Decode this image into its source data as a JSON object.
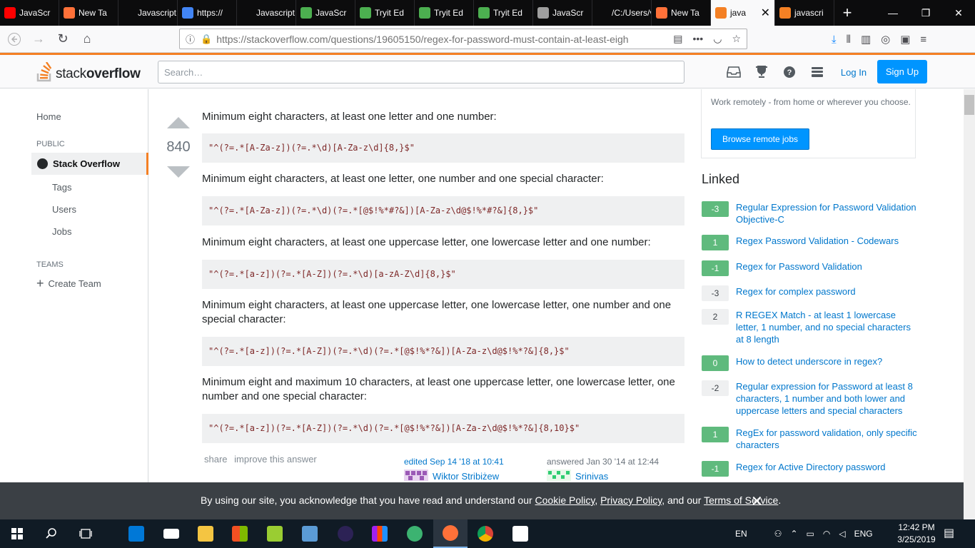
{
  "browser": {
    "tabs": [
      {
        "label": "JavaScr",
        "icon": "youtube-icon",
        "color": "#ff0000"
      },
      {
        "label": "New Ta",
        "icon": "firefox-icon",
        "color": "#ff7139"
      },
      {
        "label": "Javascript F",
        "icon": "blank-icon",
        "color": "#0c0c0d"
      },
      {
        "label": "https://",
        "icon": "google-icon",
        "color": "#4285f4"
      },
      {
        "label": "Javascript F",
        "icon": "blank-icon",
        "color": "#0c0c0d"
      },
      {
        "label": "JavaScr",
        "icon": "tryit-icon",
        "color": "#4caf50"
      },
      {
        "label": "Tryit Ed",
        "icon": "tryit-icon",
        "color": "#4caf50"
      },
      {
        "label": "Tryit Ed",
        "icon": "tryit-icon",
        "color": "#4caf50"
      },
      {
        "label": "Tryit Ed",
        "icon": "tryit-icon",
        "color": "#4caf50"
      },
      {
        "label": "JavaScr",
        "icon": "page-icon",
        "color": "#9e9e9e"
      },
      {
        "label": "/C:/Users/v",
        "icon": "blank-icon",
        "color": "#0c0c0d"
      },
      {
        "label": "New Ta",
        "icon": "firefox-icon",
        "color": "#ff7139"
      },
      {
        "label": "java",
        "icon": "stackoverflow-icon",
        "color": "#f48024",
        "active": true
      },
      {
        "label": "javascri",
        "icon": "stackoverflow-icon",
        "color": "#f48024"
      }
    ],
    "url": "https://stackoverflow.com/questions/19605150/regex-for-password-must-contain-at-least-eigh"
  },
  "header": {
    "logo_light": "stack",
    "logo_bold": "overflow",
    "search_placeholder": "Search…",
    "login": "Log In",
    "signup": "Sign Up",
    "accent": "#f48024"
  },
  "leftnav": {
    "home": "Home",
    "public": "PUBLIC",
    "stack_overflow": "Stack Overflow",
    "tags": "Tags",
    "users": "Users",
    "jobs": "Jobs",
    "teams": "TEAMS",
    "create_team": "Create Team"
  },
  "answer": {
    "votes": "840",
    "blocks": [
      {
        "text": "Minimum eight characters, at least one letter and one number:",
        "code": "\"^(?=.*[A-Za-z])(?=.*\\d)[A-Za-z\\d]{8,}$\""
      },
      {
        "text": "Minimum eight characters, at least one letter, one number and one special character:",
        "code": "\"^(?=.*[A-Za-z])(?=.*\\d)(?=.*[@$!%*#?&])[A-Za-z\\d@$!%*#?&]{8,}$\""
      },
      {
        "text": "Minimum eight characters, at least one uppercase letter, one lowercase letter and one number:",
        "code": "\"^(?=.*[a-z])(?=.*[A-Z])(?=.*\\d)[a-zA-Z\\d]{8,}$\""
      },
      {
        "text": "Minimum eight characters, at least one uppercase letter, one lowercase letter, one number and one special character:",
        "code": "\"^(?=.*[a-z])(?=.*[A-Z])(?=.*\\d)(?=.*[@$!%*?&])[A-Za-z\\d@$!%*?&]{8,}$\""
      },
      {
        "text": "Minimum eight and maximum 10 characters, at least one uppercase letter, one lowercase letter, one number and one special character:",
        "code": "\"^(?=.*[a-z])(?=.*[A-Z])(?=.*\\d)(?=.*[@$!%*?&])[A-Za-z\\d@$!%*?&]{8,10}$\""
      }
    ],
    "share": "share",
    "improve": "improve this answer",
    "edited": "edited Sep 14 '18 at 10:41",
    "editor": "Wiktor Stribiżew",
    "answered": "answered Jan 30 '14 at 12:44",
    "author": "Srinivas"
  },
  "sidebar": {
    "remote_text": "Work remotely - from home or wherever you choose.",
    "remote_button": "Browse remote jobs",
    "linked_title": "Linked",
    "linked": [
      {
        "score": "-3",
        "title": "Regular Expression for Password Validation Objective-C",
        "accepted": true
      },
      {
        "score": "1",
        "title": "Regex Password Validation - Codewars",
        "accepted": true
      },
      {
        "score": "-1",
        "title": "Regex for Password Validation",
        "accepted": true
      },
      {
        "score": "-3",
        "title": "Regex for complex password",
        "accepted": false
      },
      {
        "score": "2",
        "title": "R REGEX Match - at least 1 lowercase letter, 1 number, and no special characters at 8 length",
        "accepted": false
      },
      {
        "score": "0",
        "title": "How to detect underscore in regex?",
        "accepted": true
      },
      {
        "score": "-2",
        "title": "Regular expression for Password at least 8 characters, 1 number and both lower and uppercase letters and special characters",
        "accepted": false
      },
      {
        "score": "1",
        "title": "RegEx for password validation, only specific characters",
        "accepted": true
      },
      {
        "score": "-1",
        "title": "Regex for Active Directory password",
        "accepted": true
      }
    ]
  },
  "cookie": {
    "pre": "By using our site, you acknowledge that you have read and understand our ",
    "cookie_policy": "Cookie Policy",
    "sep1": ", ",
    "privacy_policy": "Privacy Policy",
    "sep2": ", and our ",
    "terms": "Terms of Service",
    "end": "."
  },
  "taskbar": {
    "lang": "EN",
    "ime": "ENG",
    "time": "12:42 PM",
    "date": "3/25/2019"
  }
}
